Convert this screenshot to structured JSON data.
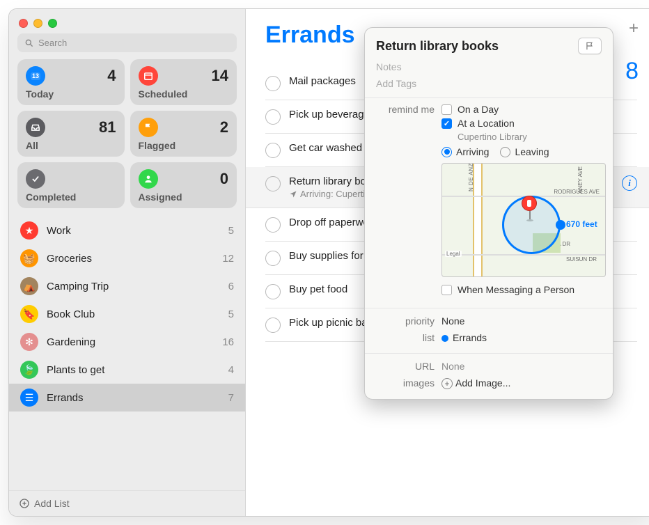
{
  "search": {
    "placeholder": "Search"
  },
  "cards": [
    {
      "label": "Today",
      "count": "4"
    },
    {
      "label": "Scheduled",
      "count": "14"
    },
    {
      "label": "All",
      "count": "81"
    },
    {
      "label": "Flagged",
      "count": "2"
    },
    {
      "label": "Completed",
      "count": ""
    },
    {
      "label": "Assigned",
      "count": "0"
    }
  ],
  "lists": [
    {
      "name": "Work",
      "count": "5",
      "color": "#ff3b30",
      "glyph": "★"
    },
    {
      "name": "Groceries",
      "count": "12",
      "color": "#ff9500",
      "glyph": "🧺"
    },
    {
      "name": "Camping Trip",
      "count": "6",
      "color": "#a2845e",
      "glyph": "⛺"
    },
    {
      "name": "Book Club",
      "count": "5",
      "color": "#ffcc00",
      "glyph": "🔖"
    },
    {
      "name": "Gardening",
      "count": "16",
      "color": "#e48f8f",
      "glyph": "✻"
    },
    {
      "name": "Plants to get",
      "count": "4",
      "color": "#34c759",
      "glyph": "🍃"
    },
    {
      "name": "Errands",
      "count": "7",
      "color": "#007aff",
      "glyph": "☰"
    }
  ],
  "addList": "Add List",
  "list": {
    "title": "Errands",
    "count": "8",
    "items": [
      {
        "title": "Mail packages"
      },
      {
        "title": "Pick up beverages"
      },
      {
        "title": "Get car washed"
      },
      {
        "title": "Return library books",
        "sub": "Arriving: Cupertino Library",
        "selected": true
      },
      {
        "title": "Drop off paperwork"
      },
      {
        "title": "Buy supplies for trip"
      },
      {
        "title": "Buy pet food"
      },
      {
        "title": "Pick up picnic basket"
      }
    ]
  },
  "popover": {
    "title": "Return library books",
    "notes_placeholder": "Notes",
    "tags_placeholder": "Add Tags",
    "remindMeLabel": "remind me",
    "onADay": "On a Day",
    "atLocation": "At a Location",
    "locationName": "Cupertino Library",
    "arriving": "Arriving",
    "leaving": "Leaving",
    "distance": "670 feet",
    "map": {
      "road_v": "N DE ANZA BLVD",
      "road_top": "RODRIGUES AVE",
      "road_bottom": "SUISUN DR",
      "road_left_bottom": "Legal",
      "road_right_v": "ANEY AVE",
      "pacifica": "PACIFICA DR"
    },
    "whenMessaging": "When Messaging a Person",
    "priorityLabel": "priority",
    "priorityValue": "None",
    "listLabel": "list",
    "listValue": "Errands",
    "urlLabel": "URL",
    "urlValue": "None",
    "imagesLabel": "images",
    "addImage": "Add Image..."
  }
}
